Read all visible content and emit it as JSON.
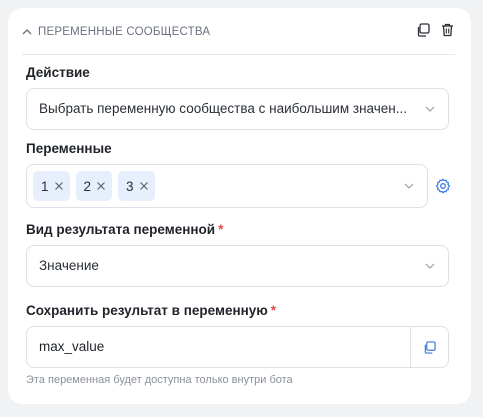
{
  "section": {
    "title": "ПЕРЕМЕННЫЕ СООБЩЕСТВА"
  },
  "action": {
    "label": "Действие",
    "value": "Выбрать переменную сообщества с наибольшим значен..."
  },
  "variables": {
    "label": "Переменные",
    "chips": [
      "1",
      "2",
      "3"
    ]
  },
  "result_type": {
    "label": "Вид результата переменной",
    "required_mark": "*",
    "value": "Значение"
  },
  "save_result": {
    "label": "Сохранить результат в переменную",
    "required_mark": "*",
    "value": "max_value",
    "hint": "Эта переменная будет доступна только внутри бота"
  },
  "colors": {
    "accent": "#3b7be0",
    "required": "#e5484d",
    "chip_bg": "#e6effb"
  },
  "icons": {
    "collapse": "chevron-up-icon",
    "duplicate": "copy-icon",
    "delete": "trash-icon",
    "dropdown": "chevron-down-icon",
    "settings": "gear-icon",
    "remove_chip": "close-icon",
    "copy_value": "copy-icon"
  }
}
